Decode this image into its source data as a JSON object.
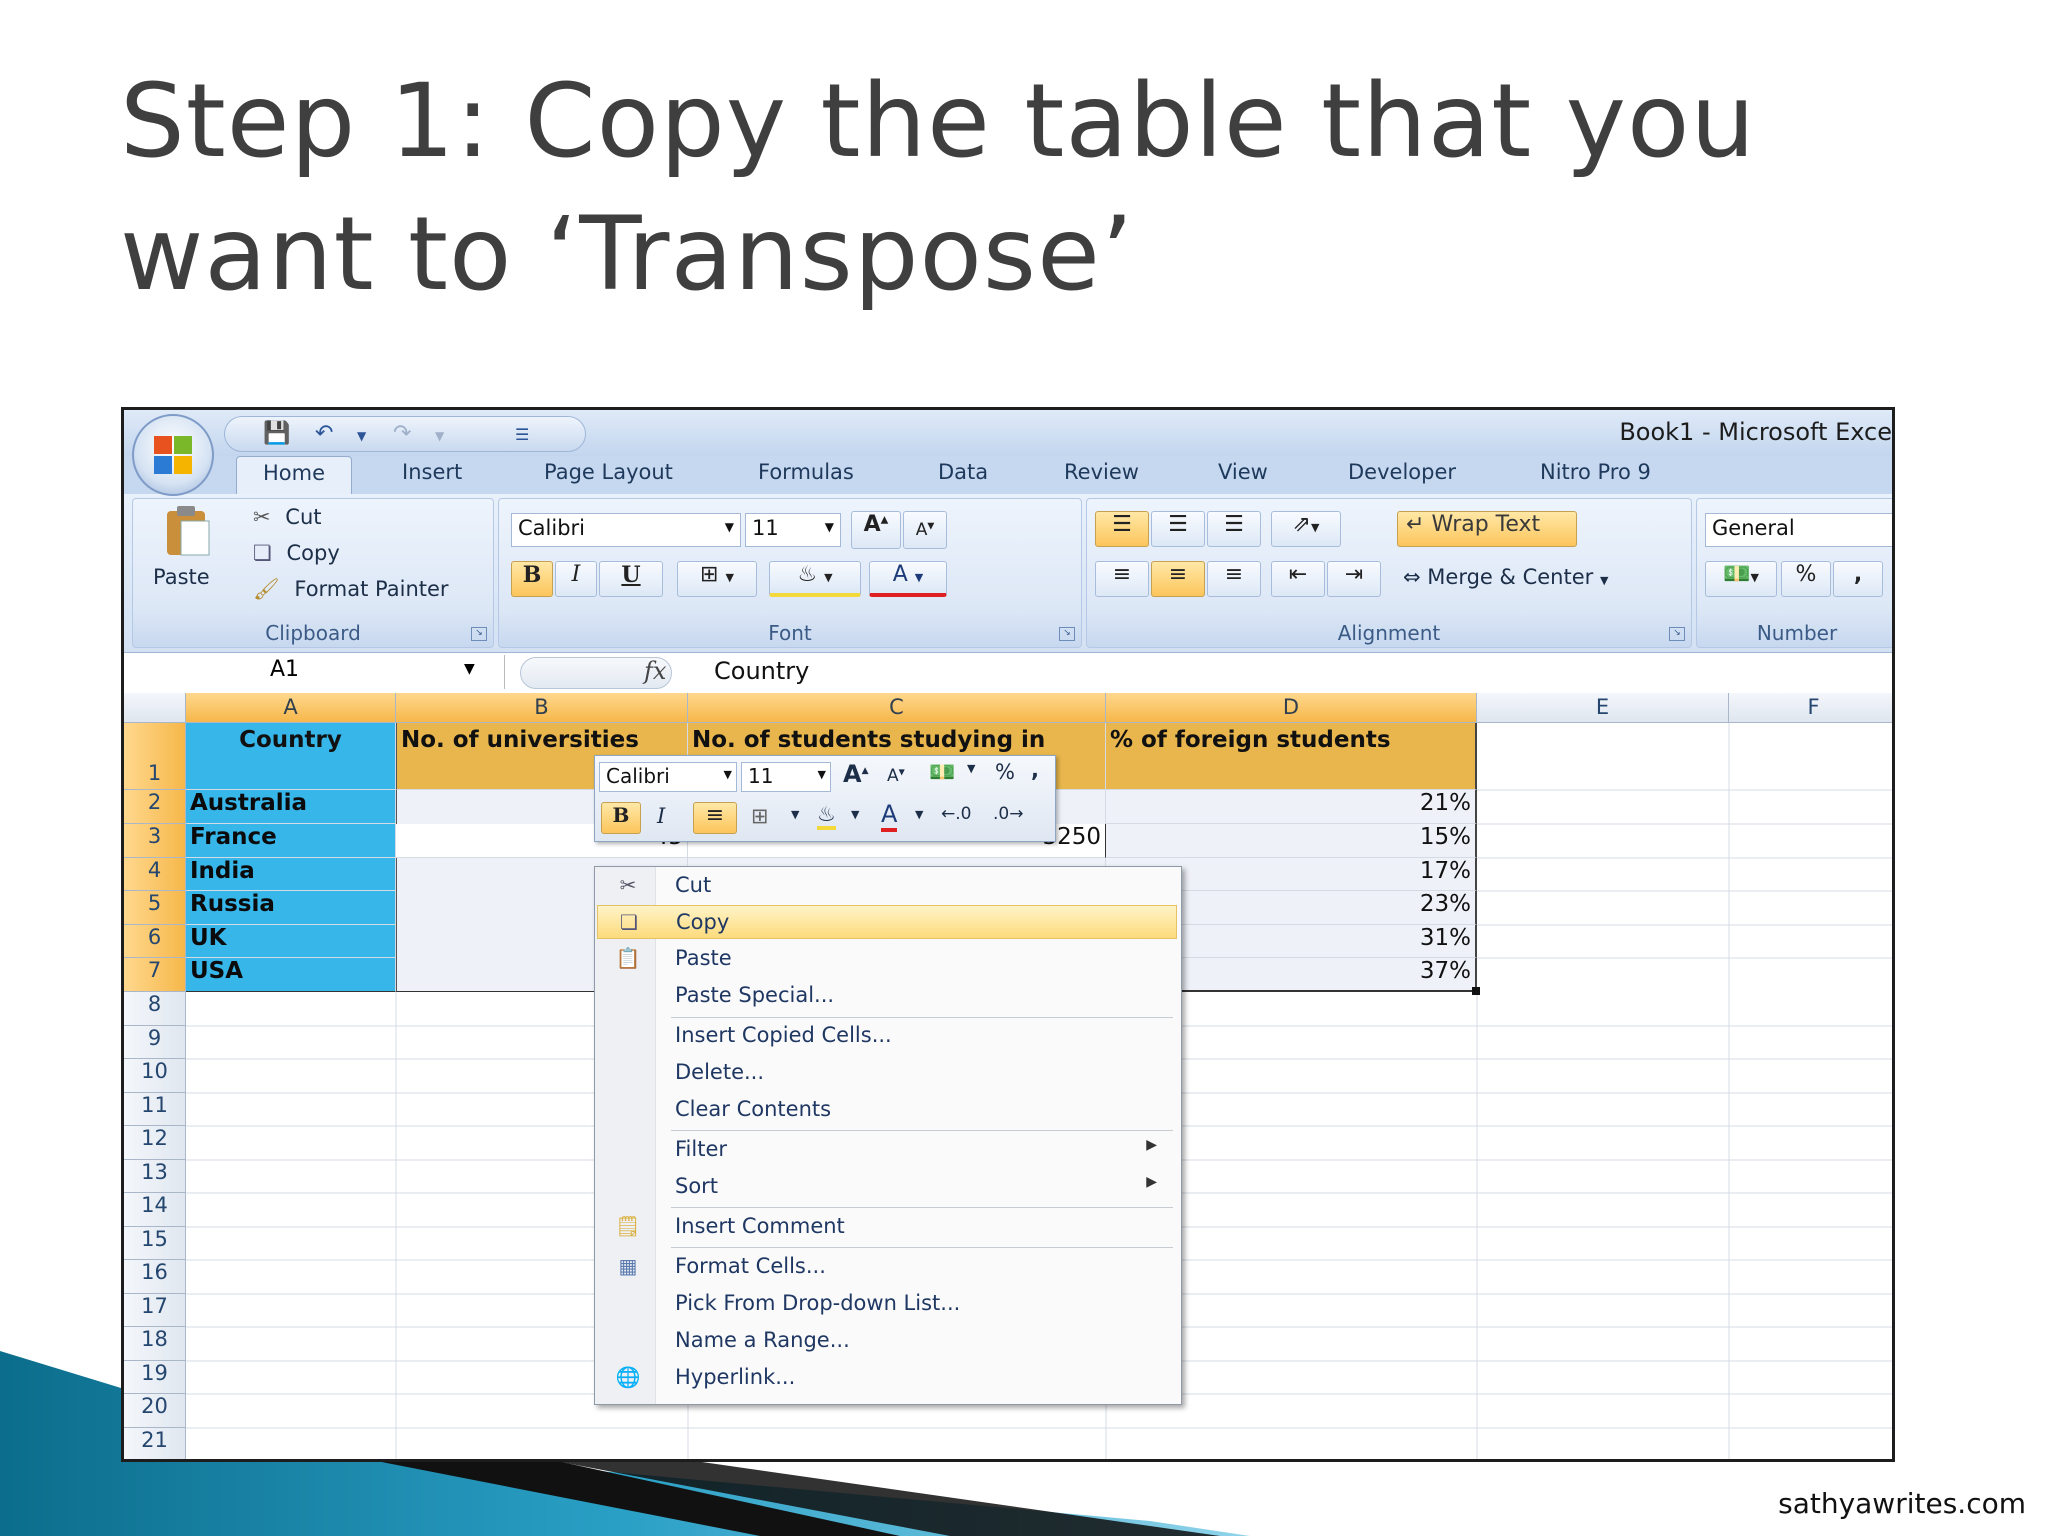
{
  "slide": {
    "title_line1": "Step 1: Copy the table that you",
    "title_line2": "want to ‘Transpose’",
    "footer": "sathyawrites.com"
  },
  "window": {
    "title": "Book1 - Microsoft Exce"
  },
  "ribbon_tabs": [
    "Home",
    "Insert",
    "Page Layout",
    "Formulas",
    "Data",
    "Review",
    "View",
    "Developer",
    "Nitro Pro 9"
  ],
  "clipboard": {
    "paste": "Paste",
    "cut": "Cut",
    "copy": "Copy",
    "format_painter": "Format Painter",
    "label": "Clipboard"
  },
  "font": {
    "name": "Calibri",
    "size": "11",
    "label": "Font",
    "bold": "B",
    "italic": "I",
    "underline": "U"
  },
  "alignment": {
    "wrap_text": "Wrap Text",
    "merge_center": "Merge & Center",
    "label": "Alignment"
  },
  "number": {
    "format": "General",
    "percent": "%",
    "comma": ",",
    "label": "Number"
  },
  "formula_bar": {
    "name_box": "A1",
    "fx": "fx",
    "value": "Country"
  },
  "columns": [
    "A",
    "B",
    "C",
    "D",
    "E",
    "F"
  ],
  "rows": [
    "1",
    "2",
    "3",
    "4",
    "5",
    "6",
    "7",
    "8",
    "9",
    "10",
    "11",
    "12",
    "13",
    "14",
    "15",
    "16",
    "17",
    "18",
    "19",
    "20",
    "21"
  ],
  "headers": {
    "a": "Country",
    "b": "No. of universities",
    "c": "No. of students studying in",
    "d": "% of foreign students"
  },
  "countries": [
    "Australia",
    "France",
    "India",
    "Russia",
    "UK",
    "USA"
  ],
  "visible_values": {
    "b3": "45",
    "c3": "3250",
    "d": [
      "21%",
      "15%",
      "17%",
      "23%",
      "31%",
      "37%"
    ]
  },
  "mini_toolbar": {
    "font": "Calibri",
    "size": "11",
    "percent": "%",
    "comma": ","
  },
  "context_menu": [
    "Cut",
    "Copy",
    "Paste",
    "Paste Special...",
    "Insert Copied Cells...",
    "Delete...",
    "Clear Contents",
    "Filter",
    "Sort",
    "Insert Comment",
    "Format Cells...",
    "Pick From Drop-down List...",
    "Name a Range...",
    "Hyperlink..."
  ],
  "colors": {
    "country_fill": "#37b6ea",
    "header_fill": "#e8b64d",
    "menu_highlight": "#fddb7c"
  }
}
